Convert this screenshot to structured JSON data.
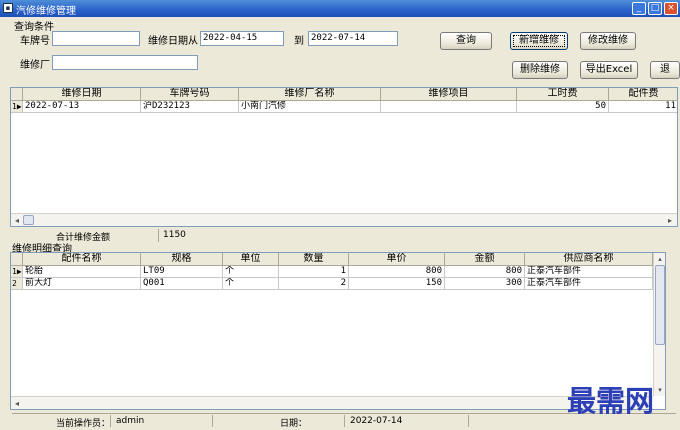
{
  "window": {
    "title": "汽修维修管理",
    "min": "_",
    "max": "□",
    "close": "×"
  },
  "query": {
    "group_title": "查询条件",
    "plate_label": "车牌号",
    "plate_value": "",
    "date_from_label": "维修日期从",
    "date_from": "2022-04-15",
    "date_to_label": "到",
    "date_to": "2022-07-14",
    "shop_label": "维修厂",
    "shop_value": ""
  },
  "buttons": {
    "query": "查询",
    "add": "新增维修",
    "edit": "修改维修",
    "delete": "删除维修",
    "export": "导出Excel",
    "extra": "退"
  },
  "main_table": {
    "headers": [
      "维修日期",
      "车牌号码",
      "维修厂名称",
      "维修项目",
      "工时费",
      "配件费"
    ],
    "rows": [
      {
        "index": "1",
        "date": "2022-07-13",
        "plate": "沪D232123",
        "shop": "小南门汽修",
        "item": "",
        "labor": "50",
        "parts": "11"
      }
    ]
  },
  "summary": {
    "label": "合计维修金额",
    "value": "1150"
  },
  "detail": {
    "title": "维修明细查询",
    "headers": [
      "配件名称",
      "规格",
      "单位",
      "数量",
      "单价",
      "金额",
      "供应商名称"
    ],
    "rows": [
      {
        "index": "1",
        "name": "轮胎",
        "spec": "LT09",
        "unit": "个",
        "qty": "1",
        "price": "800",
        "amount": "800",
        "supplier": "正泰汽车部件"
      },
      {
        "index": "2",
        "name": "前大灯",
        "spec": "Q001",
        "unit": "个",
        "qty": "2",
        "price": "150",
        "amount": "300",
        "supplier": "正泰汽车部件"
      }
    ]
  },
  "status": {
    "operator_label": "当前操作员：",
    "operator": "admin",
    "date_label": "日期：",
    "date": "2022-07-14"
  },
  "watermark": "最需网"
}
